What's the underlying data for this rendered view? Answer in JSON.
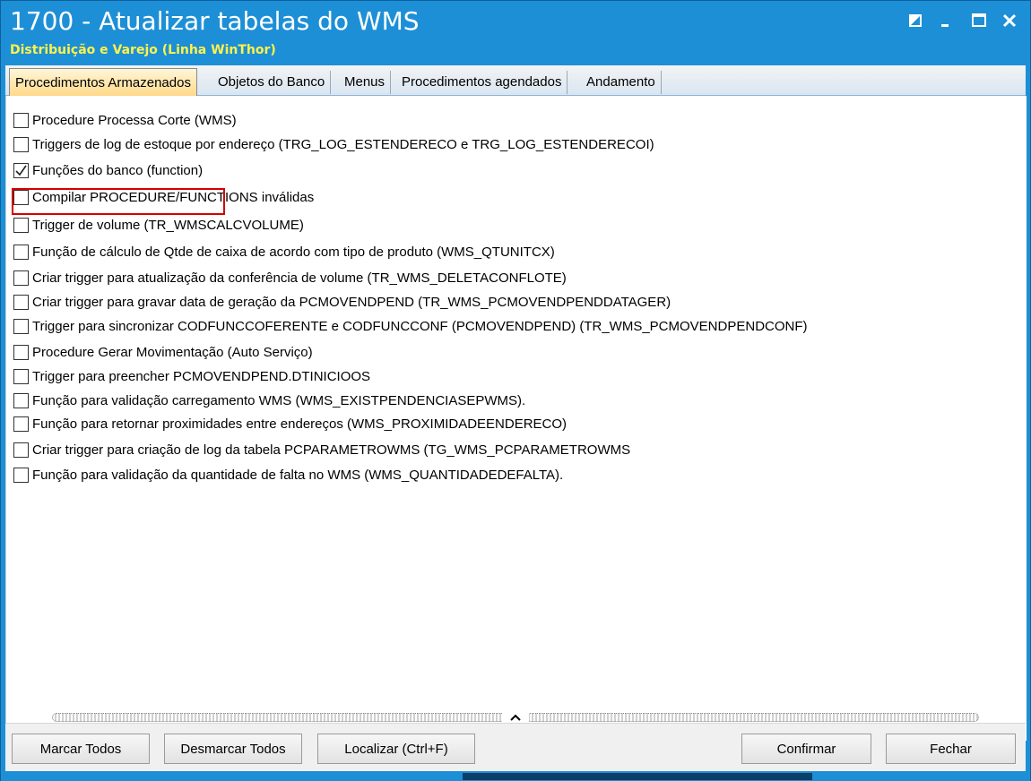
{
  "window": {
    "title": "1700 - Atualizar tabelas do WMS",
    "subtitle": "Distribuição e Varejo (Linha WinThor)",
    "title_color": "#ffffff",
    "subtitle_color": "#fff24a",
    "frame_color": "#1d8fd6",
    "controls": [
      "restore-icon",
      "minimize-icon",
      "maximize-icon",
      "close-icon"
    ]
  },
  "tabs": [
    {
      "label": "Procedimentos Armazenados",
      "active": true
    },
    {
      "label": "Objetos do Banco",
      "active": false
    },
    {
      "label": "Menus",
      "active": false
    },
    {
      "label": "Procedimentos agendados",
      "active": false
    },
    {
      "label": "Andamento",
      "active": false
    }
  ],
  "items": [
    {
      "label": "Procedure Processa Corte (WMS)",
      "checked": false
    },
    {
      "label": "Triggers de log de estoque por endereço (TRG_LOG_ESTENDERECO e TRG_LOG_ESTENDERECOI)",
      "checked": false
    },
    {
      "label": "Funções do banco (function)",
      "checked": true
    },
    {
      "label": "Compilar PROCEDURE/FUNCTIONS inválidas",
      "checked": false
    },
    {
      "label": "Trigger de volume (TR_WMSCALCVOLUME)",
      "checked": false
    },
    {
      "label": "Função de cálculo de Qtde de caixa de acordo com tipo de produto (WMS_QTUNITCX)",
      "checked": false
    },
    {
      "label": "Criar trigger para atualização da conferência de volume (TR_WMS_DELETACONFLOTE)",
      "checked": false
    },
    {
      "label": "Criar trigger para gravar data de geração da PCMOVENDPEND (TR_WMS_PCMOVENDPENDDATAGER)",
      "checked": false
    },
    {
      "label": "Trigger para sincronizar CODFUNCCOFERENTE e CODFUNCCONF (PCMOVENDPEND) (TR_WMS_PCMOVENDPENDCONF)",
      "checked": false
    },
    {
      "label": "Procedure Gerar Movimentação (Auto Serviço)",
      "checked": false
    },
    {
      "label": "Trigger para preencher PCMOVENDPEND.DTINICIOOS",
      "checked": false
    },
    {
      "label": "Função para validação carregamento WMS (WMS_EXISTPENDENCIASEPWMS).",
      "checked": false
    },
    {
      "label": "Função para retornar proximidades entre endereços (WMS_PROXIMIDADEENDERECO)",
      "checked": false
    },
    {
      "label": "Criar trigger para criação de log da tabela PCPARAMETROWMS (TG_WMS_PCPARAMETROWMS",
      "checked": false
    },
    {
      "label": "Função para validação da quantidade de falta no WMS (WMS_QUANTIDADEDEFALTA).",
      "checked": false
    }
  ],
  "buttons": {
    "marcar_todos": "Marcar Todos",
    "desmarcar_todos": "Desmarcar Todos",
    "localizar": "Localizar (Ctrl+F)",
    "confirmar": "Confirmar",
    "fechar": "Fechar"
  },
  "highlight_color": "#d40000"
}
